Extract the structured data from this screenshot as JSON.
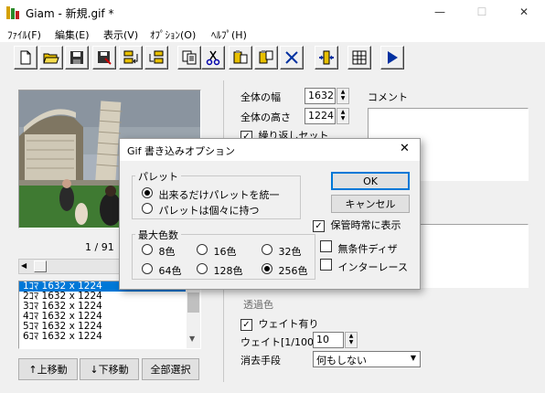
{
  "window": {
    "title": "Giam - 新規.gif *",
    "minimize": "—",
    "maximize": "☐",
    "close": "✕"
  },
  "menu": [
    "ﾌｧｲﾙ(F)",
    "編集(E)",
    "表示(V)",
    "ｵﾌﾟｼｮﾝ(O)",
    "ﾍﾙﾌﾟ(H)"
  ],
  "toolbar": {
    "icons": [
      "new-file-icon",
      "open-folder-icon",
      "save-icon",
      "save-as-icon",
      "import-icon",
      "export-icon",
      "copy-icon",
      "cut-icon",
      "paste-before-icon",
      "paste-after-icon",
      "delete-icon",
      "fit-icon",
      "grid-icon",
      "play-icon"
    ]
  },
  "left": {
    "page_counter": "1 / 91",
    "frames": [
      "1ｺﾏ 1632 x 1224",
      "2ｺﾏ 1632 x 1224",
      "3ｺﾏ 1632 x 1224",
      "4ｺﾏ 1632 x 1224",
      "5ｺﾏ 1632 x 1224",
      "6ｺﾏ 1632 x 1224"
    ],
    "move_up": "↑上移動",
    "move_down": "↓下移動",
    "select_all": "全部選択"
  },
  "right": {
    "total_width_label": "全体の幅",
    "total_width": "1632",
    "total_height_label": "全体の高さ",
    "total_height": "1224",
    "comment_label": "コメント",
    "loop_set_label": "繰り返しセット",
    "transparent_label": "透過色",
    "wait_label": "ウェイト有り",
    "wait_unit_label": "ウェイト[1/100s]",
    "wait_value": "10",
    "disposal_label": "消去手段",
    "disposal_value": "何もしない"
  },
  "dialog": {
    "title": "Gif 書き込みオプション",
    "palette_group": "パレット",
    "palette_opt1": "出来るだけパレットを統一",
    "palette_opt2": "パレットは個々に持つ",
    "maxcolors_group": "最大色数",
    "colors": [
      "8色",
      "16色",
      "32色",
      "64色",
      "128色",
      "256色"
    ],
    "selected_colors": "256色",
    "ok": "OK",
    "cancel": "キャンセル",
    "always_show": "保管時常に表示",
    "no_dither": "無条件ディザ",
    "interlace": "インターレース"
  }
}
